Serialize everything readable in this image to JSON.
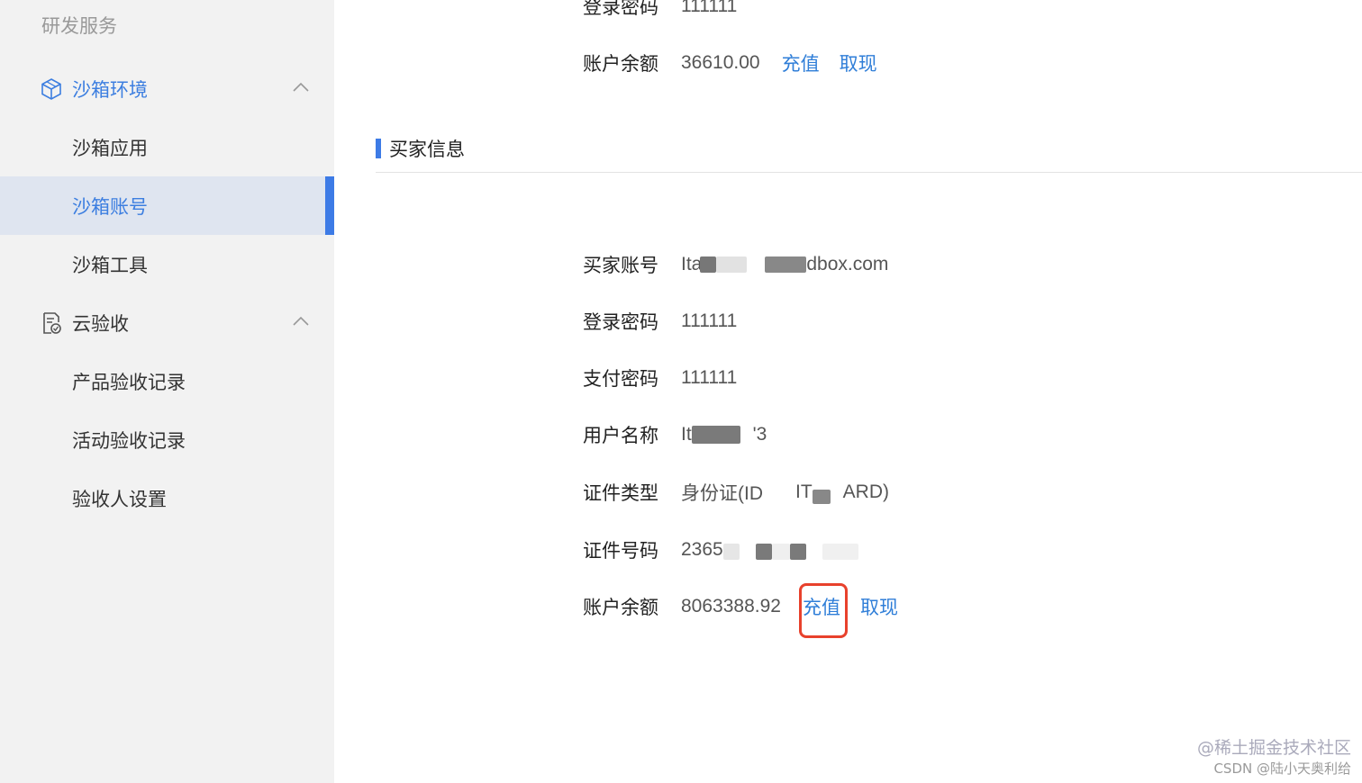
{
  "sidebar": {
    "section_title": "研发服务",
    "groups": [
      {
        "label": "沙箱环境",
        "icon": "cube-icon",
        "items": [
          "沙箱应用",
          "沙箱账号",
          "沙箱工具"
        ]
      },
      {
        "label": "云验收",
        "icon": "document-check-icon",
        "items": [
          "产品验收记录",
          "活动验收记录",
          "验收人设置"
        ]
      }
    ],
    "active_item": "沙箱账号"
  },
  "seller": {
    "login_password_label": "登录密码",
    "login_password_value": "111111",
    "balance_label": "账户余额",
    "balance_value": "36610.00",
    "recharge": "充值",
    "withdraw": "取现"
  },
  "buyer": {
    "section_title": "买家信息",
    "account_label": "买家账号",
    "account_value_start": "Ita",
    "account_value_end": "dbox.com",
    "login_password_label": "登录密码",
    "login_password_value": "111111",
    "pay_password_label": "支付密码",
    "pay_password_value": "111111",
    "username_label": "用户名称",
    "username_value_start": "It",
    "username_value_end": "'3",
    "id_type_label": "证件类型",
    "id_type_value_start": "身份证(ID",
    "id_type_value_mid": "IT",
    "id_type_value_end": "ARD)",
    "id_number_label": "证件号码",
    "id_number_value_start": "2365",
    "balance_label": "账户余额",
    "balance_value": "8063388.92",
    "recharge": "充值",
    "withdraw": "取现"
  },
  "watermark": {
    "line1": "@稀土掘金技术社区",
    "line2": "CSDN @陆小天奥利给"
  },
  "colors": {
    "accent": "#3d7be6",
    "link": "#2f7ed8",
    "highlight_box": "#e8412c",
    "sidebar_bg": "#f2f2f2",
    "active_bg": "#dfe5f0"
  }
}
